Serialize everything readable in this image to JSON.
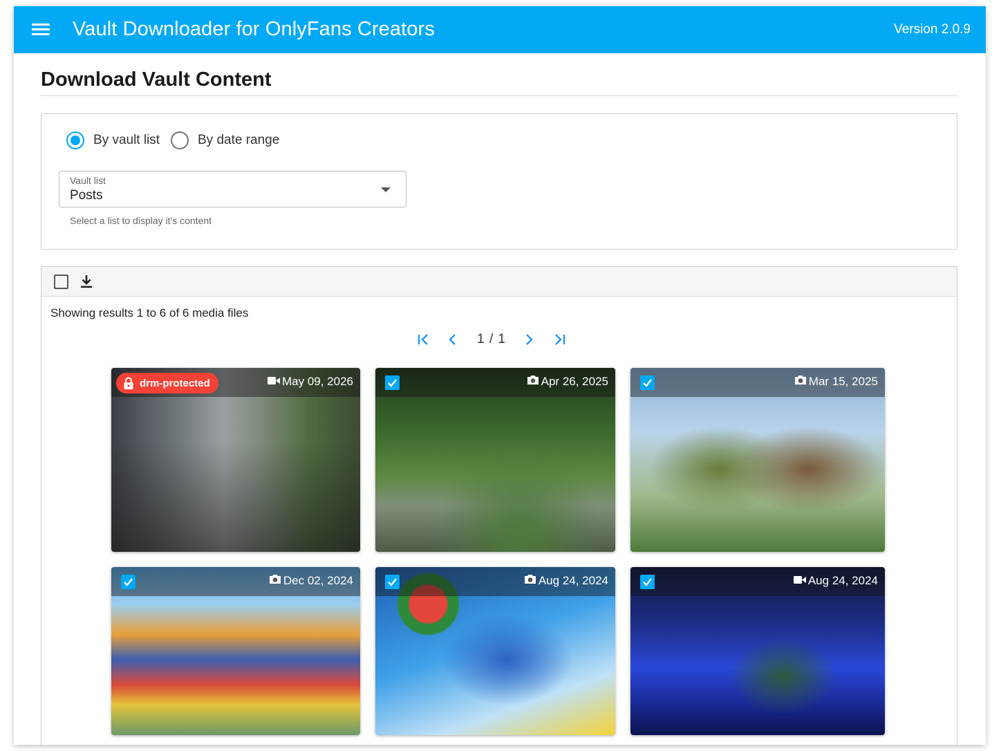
{
  "appbar": {
    "title": "Vault Downloader for OnlyFans Creators",
    "version": "Version 2.0.9",
    "color": "#03a9f4"
  },
  "page": {
    "title": "Download Vault Content"
  },
  "filter": {
    "options": [
      {
        "label": "By vault list",
        "selected": true
      },
      {
        "label": "By date range",
        "selected": false
      }
    ],
    "vault_list": {
      "label": "Vault list",
      "value": "Posts",
      "hint": "Select a list to display it's content"
    }
  },
  "results": {
    "summary": "Showing results 1 to 6 of 6 media files",
    "pagination": "1 / 1",
    "media": [
      {
        "type": "video",
        "date": "May 09, 2026",
        "badge": "drm-protected",
        "checked": false,
        "image": "city-street"
      },
      {
        "type": "photo",
        "date": "Apr 26, 2025",
        "checked": true,
        "image": "forest-stream"
      },
      {
        "type": "photo",
        "date": "Mar 15, 2025",
        "checked": true,
        "image": "supertrees"
      },
      {
        "type": "photo",
        "date": "Dec 02, 2024",
        "checked": true,
        "image": "colorful-houses"
      },
      {
        "type": "photo",
        "date": "Aug 24, 2024",
        "checked": true,
        "image": "tech-illustration"
      },
      {
        "type": "video",
        "date": "Aug 24, 2024",
        "checked": true,
        "image": "christmas-lights"
      }
    ]
  },
  "colors": {
    "accent": "#03a9f4",
    "drm_badge": "#f44336"
  }
}
